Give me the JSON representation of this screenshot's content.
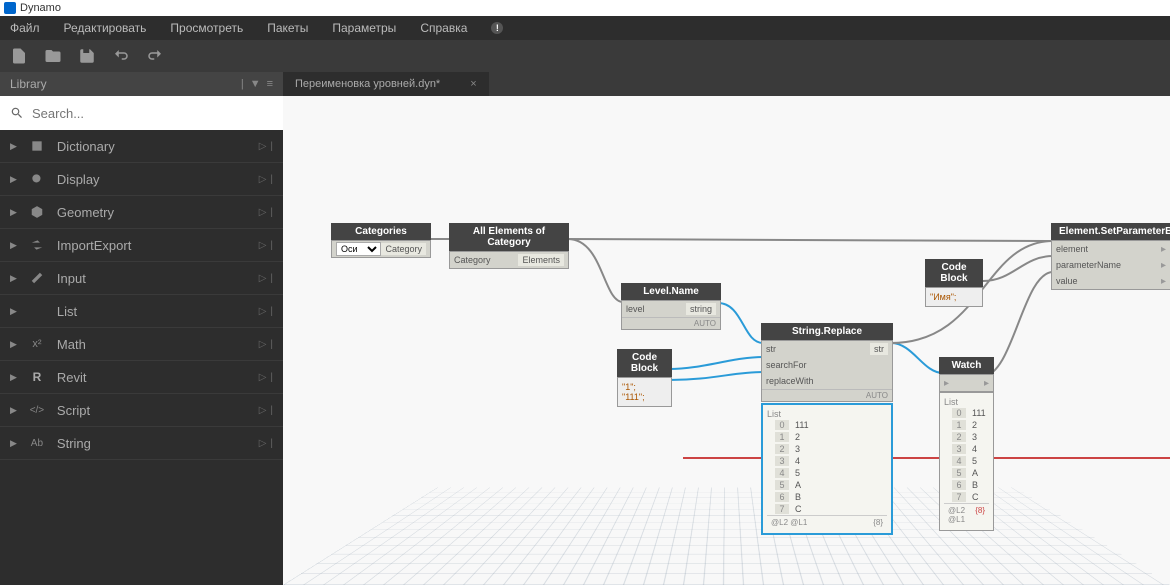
{
  "app": {
    "title": "Dynamo"
  },
  "menu": {
    "items": [
      "Файл",
      "Редактировать",
      "Просмотреть",
      "Пакеты",
      "Параметры",
      "Справка"
    ],
    "notify": "!"
  },
  "tab": {
    "name": "Переименовка уровней.dyn*"
  },
  "sidebar": {
    "title": "Library",
    "search_placeholder": "Search...",
    "items": [
      {
        "label": "Dictionary"
      },
      {
        "label": "Display"
      },
      {
        "label": "Geometry"
      },
      {
        "label": "ImportExport"
      },
      {
        "label": "Input"
      },
      {
        "label": "List"
      },
      {
        "label": "Math"
      },
      {
        "label": "Revit"
      },
      {
        "label": "Script"
      },
      {
        "label": "String"
      }
    ]
  },
  "nodes": {
    "categories": {
      "title": "Categories",
      "value": "Оси",
      "out": "Category"
    },
    "allElements": {
      "title": "All Elements of Category",
      "in": "Category",
      "out": "Elements"
    },
    "levelName": {
      "title": "Level.Name",
      "in": "level",
      "out": "string",
      "footer": "AUTO"
    },
    "codeBlock1": {
      "title": "Code Block",
      "lines": [
        "\"1\";",
        "\"111\";"
      ]
    },
    "stringReplace": {
      "title": "String.Replace",
      "in1": "str",
      "in2": "searchFor",
      "in3": "replaceWith",
      "out": "str",
      "footer": "AUTO"
    },
    "codeBlock2": {
      "title": "Code Block",
      "line": "\"Имя\";"
    },
    "watch": {
      "title": "Watch"
    },
    "setParam": {
      "title": "Element.SetParameterB",
      "in1": "element",
      "in2": "parameterName",
      "in3": "value"
    },
    "output_list_label": "List",
    "output_items": [
      {
        "idx": "0",
        "val": "111"
      },
      {
        "idx": "1",
        "val": "2"
      },
      {
        "idx": "2",
        "val": "3"
      },
      {
        "idx": "3",
        "val": "4"
      },
      {
        "idx": "4",
        "val": "5"
      },
      {
        "idx": "5",
        "val": "A"
      },
      {
        "idx": "6",
        "val": "B"
      },
      {
        "idx": "7",
        "val": "C"
      }
    ],
    "output_footer_left": "@L2 @L1",
    "output_footer_right": "{8}",
    "watch_items": [
      {
        "idx": "0",
        "val": "111"
      },
      {
        "idx": "1",
        "val": "2"
      },
      {
        "idx": "2",
        "val": "3"
      },
      {
        "idx": "3",
        "val": "4"
      },
      {
        "idx": "4",
        "val": "5"
      },
      {
        "idx": "5",
        "val": "A"
      },
      {
        "idx": "6",
        "val": "B"
      },
      {
        "idx": "7",
        "val": "C"
      }
    ],
    "watch_footer_left": "@L2 @L1",
    "watch_footer_right": "{8}"
  }
}
